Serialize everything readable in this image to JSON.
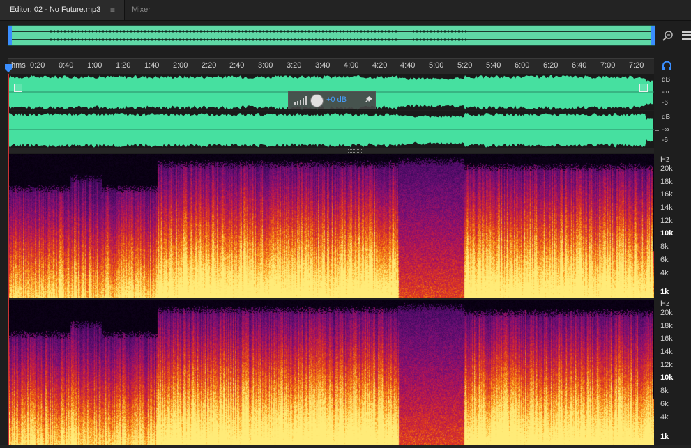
{
  "tabs": {
    "editor_label": "Editor: 02 - No Future.mp3",
    "menu_glyph": "≡",
    "mixer_label": "Mixer"
  },
  "colors": {
    "waveform": "#46e0a0",
    "waveform_overview": "#5fd8a6",
    "accent": "#3a8eff",
    "background": "#1e1e1e"
  },
  "icons": [
    "zoom-icon",
    "panel-icon",
    "headphone-icon",
    "playhead-icon",
    "pin-icon",
    "knob-icon",
    "volume-bars-icon",
    "fade-handle-icon"
  ],
  "ruler": {
    "unit_label": "hms",
    "labels": [
      "0:20",
      "0:40",
      "1:00",
      "1:20",
      "1:40",
      "2:00",
      "2:20",
      "2:40",
      "3:00",
      "3:20",
      "3:40",
      "4:00",
      "4:20",
      "4:40",
      "5:00",
      "5:20",
      "5:40",
      "6:00",
      "6:20",
      "6:40",
      "7:00",
      "7:20"
    ]
  },
  "hud": {
    "gain_value": "+0 dB"
  },
  "db_scale": {
    "channel1": [
      "dB",
      "-∞",
      "-6"
    ],
    "channel2": [
      "dB",
      "-∞",
      "-6"
    ]
  },
  "hz_scale": {
    "unit": "Hz",
    "labels": [
      "20k",
      "18k",
      "16k",
      "14k",
      "12k",
      "10k",
      "8k",
      "6k",
      "4k",
      "1k"
    ]
  }
}
